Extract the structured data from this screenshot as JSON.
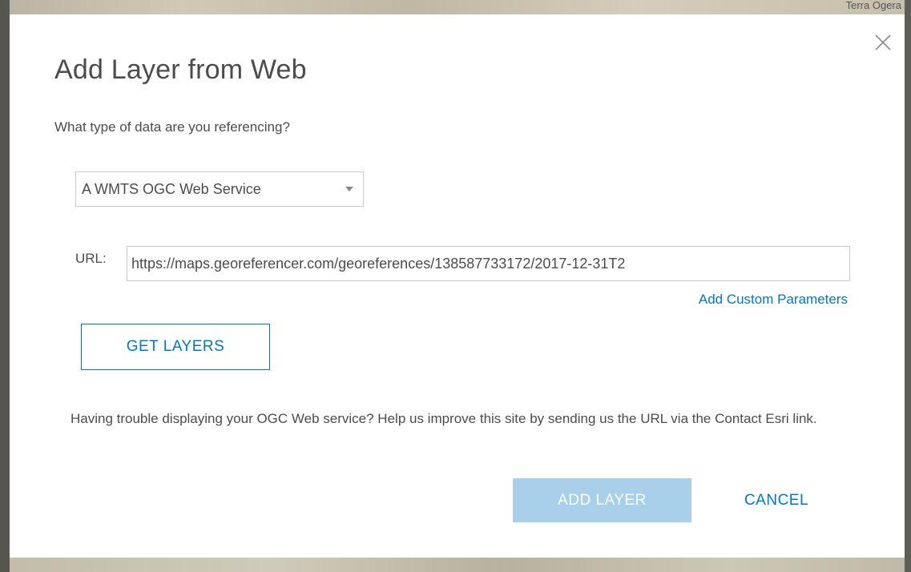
{
  "background": {
    "map_label": "Terra Ogera"
  },
  "dialog": {
    "title": "Add Layer from Web",
    "question": "What type of data are you referencing?",
    "data_type": {
      "selected": "A WMTS OGC Web Service"
    },
    "url": {
      "label": "URL:",
      "value": "https://maps.georeferencer.com/georeferences/138587733172/2017-12-31T2"
    },
    "custom_params_link": "Add Custom Parameters",
    "get_layers_label": "GET LAYERS",
    "help_text": "Having trouble displaying your OGC Web service? Help us improve this site by sending us the URL via the Contact Esri link.",
    "add_layer_label": "ADD LAYER",
    "cancel_label": "CANCEL"
  },
  "colors": {
    "accent": "#0079c1",
    "disabled_button": "#a8d0ea",
    "text": "#4c4c4c",
    "border": "#cccccc"
  },
  "icons": {
    "close": "close-icon",
    "dropdown": "chevron-down-icon"
  }
}
